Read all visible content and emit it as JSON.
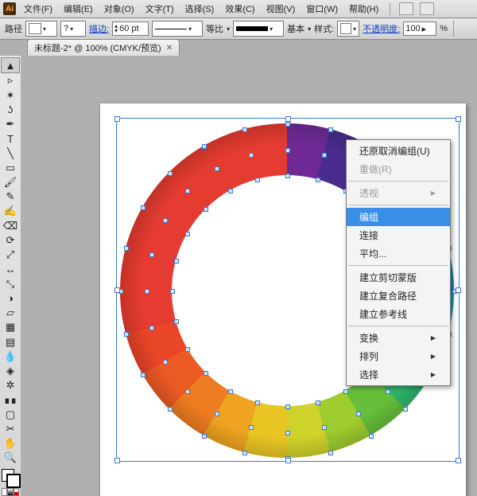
{
  "menubar": {
    "items": [
      "文件(F)",
      "编辑(E)",
      "对象(O)",
      "文字(T)",
      "选择(S)",
      "效果(C)",
      "视图(V)",
      "窗口(W)",
      "帮助(H)"
    ]
  },
  "options_bar": {
    "path_label": "路径",
    "fill_value": "",
    "help_value": "?",
    "stroke_label": "描边:",
    "stroke_weight": "60 pt",
    "uniform_label": "等比",
    "basic_label": "基本",
    "style_label": "样式:",
    "opacity_label": "不透明度:",
    "opacity_value": "100",
    "opacity_unit": "%"
  },
  "tab": {
    "title": "未标题-2* @ 100% (CMYK/预览)"
  },
  "tools": [
    {
      "name": "selection-tool",
      "glyph": "▲",
      "sel": true
    },
    {
      "name": "direct-selection-tool",
      "glyph": "▹"
    },
    {
      "name": "magic-wand-tool",
      "glyph": "✶"
    },
    {
      "name": "lasso-tool",
      "glyph": "ʖ"
    },
    {
      "name": "pen-tool",
      "glyph": "✒"
    },
    {
      "name": "type-tool",
      "glyph": "T"
    },
    {
      "name": "line-tool",
      "glyph": "╲"
    },
    {
      "name": "rectangle-tool",
      "glyph": "▭"
    },
    {
      "name": "paintbrush-tool",
      "glyph": "🖌"
    },
    {
      "name": "pencil-tool",
      "glyph": "✎"
    },
    {
      "name": "blob-brush-tool",
      "glyph": "✍"
    },
    {
      "name": "eraser-tool",
      "glyph": "⌫"
    },
    {
      "name": "rotate-tool",
      "glyph": "⟳"
    },
    {
      "name": "scale-tool",
      "glyph": "⤢"
    },
    {
      "name": "width-tool",
      "glyph": "↔"
    },
    {
      "name": "free-transform-tool",
      "glyph": "⤡"
    },
    {
      "name": "shape-builder-tool",
      "glyph": "◑"
    },
    {
      "name": "perspective-tool",
      "glyph": "▱"
    },
    {
      "name": "mesh-tool",
      "glyph": "▦"
    },
    {
      "name": "gradient-tool",
      "glyph": "▤"
    },
    {
      "name": "eyedropper-tool",
      "glyph": "💧"
    },
    {
      "name": "blend-tool",
      "glyph": "◈"
    },
    {
      "name": "symbol-sprayer-tool",
      "glyph": "✲"
    },
    {
      "name": "column-graph-tool",
      "glyph": "∎∎"
    },
    {
      "name": "artboard-tool",
      "glyph": "▢"
    },
    {
      "name": "slice-tool",
      "glyph": "✂"
    },
    {
      "name": "hand-tool",
      "glyph": "✋"
    },
    {
      "name": "zoom-tool",
      "glyph": "🔍"
    }
  ],
  "context_menu": {
    "items": [
      {
        "label": "还原取消编组(U)",
        "type": "item"
      },
      {
        "label": "重做(R)",
        "type": "disabled"
      },
      {
        "type": "sep"
      },
      {
        "label": "透视",
        "type": "sub-disabled"
      },
      {
        "type": "sep"
      },
      {
        "label": "编组",
        "type": "highlight"
      },
      {
        "label": "连接",
        "type": "item"
      },
      {
        "label": "平均...",
        "type": "item"
      },
      {
        "type": "sep"
      },
      {
        "label": "建立剪切蒙版",
        "type": "item"
      },
      {
        "label": "建立复合路径",
        "type": "item"
      },
      {
        "label": "建立参考线",
        "type": "item"
      },
      {
        "type": "sep"
      },
      {
        "label": "变换",
        "type": "sub"
      },
      {
        "label": "排列",
        "type": "sub"
      },
      {
        "label": "选择",
        "type": "sub"
      }
    ]
  },
  "ring_colors": [
    "#e03a3a",
    "#e2242a",
    "#d71d5b",
    "#d11a86",
    "#bd1d97",
    "#9b239e",
    "#6f2a97",
    "#4a2c8e",
    "#343d9b",
    "#2256a8",
    "#167bb8",
    "#0f9ec6",
    "#0fb7c0",
    "#14b89c",
    "#2fb76a",
    "#66bf3a",
    "#9fcc2e",
    "#cfd22a",
    "#e8c523",
    "#efa320",
    "#ee7c20",
    "#ec5a24",
    "#e94528",
    "#e53b30"
  ]
}
